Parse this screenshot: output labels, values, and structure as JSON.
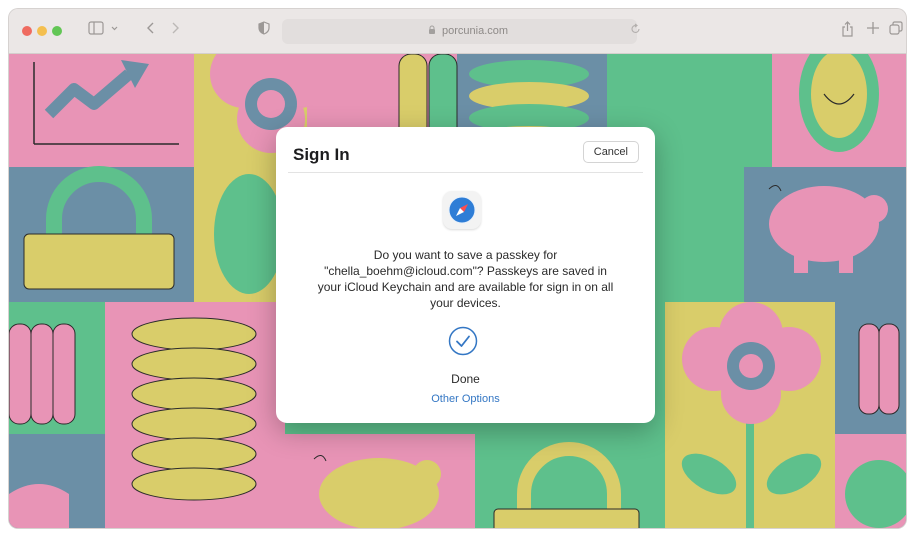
{
  "browser": {
    "address_url": "porcunia.com",
    "icons": {
      "traffic_lights": [
        "close-light",
        "minimize-light",
        "zoom-light"
      ],
      "sidebar": "sidebar-icon",
      "sidebar_menu": "chevron-down-icon",
      "back": "chevron-left-icon",
      "forward": "chevron-right-icon",
      "privacy": "shield-icon",
      "reload": "reload-icon",
      "share": "share-icon",
      "new_tab": "plus-icon",
      "tab_overview": "tabs-icon"
    }
  },
  "dialog": {
    "title": "Sign In",
    "cancel_label": "Cancel",
    "app_icon": "safari-compass-icon",
    "message_lines": [
      "Do you want to save a passkey for",
      "\"chella_boehm@icloud.com\"? Passkeys are saved in",
      "your iCloud Keychain and are available for sign in on all",
      "your devices."
    ],
    "status_icon": "checkmark-circle-icon",
    "done_label": "Done",
    "other_options_label": "Other Options"
  },
  "colors": {
    "pink": "#e894b6",
    "yellow": "#d9cd6a",
    "green": "#5ec08c",
    "blue_gray": "#6b8fa6",
    "link_blue": "#3477c4",
    "safari_blue": "#2e7dd6"
  }
}
